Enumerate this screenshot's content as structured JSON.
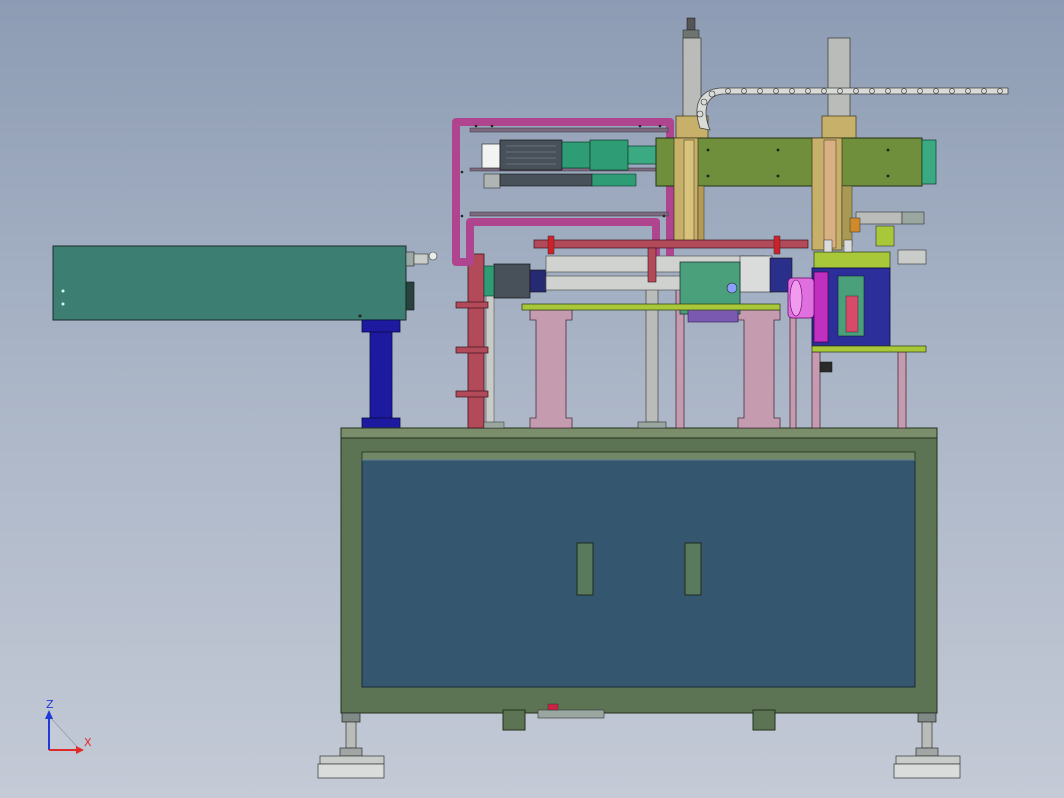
{
  "triad": {
    "z_label": "Z",
    "x_label": "X"
  },
  "colors": {
    "background_top": "#8d9cb4",
    "background_bottom": "#c4cad6",
    "cabinet_frame": "#5d7454",
    "cabinet_panel": "#34566f",
    "teal_module": "#3c7e72",
    "blue_column": "#1d1aa0",
    "magenta_frame": "#b0458f",
    "olive_carriage": "#6f8f3c",
    "pink_supports": "#c59bb0",
    "cylinder_grey": "#b9bcb9",
    "motor_green": "#2e9c74",
    "red_post": "#b34a5a",
    "purple_block": "#c030c0",
    "triad_z": "#1f3ad6",
    "triad_x": "#e02a2a"
  }
}
